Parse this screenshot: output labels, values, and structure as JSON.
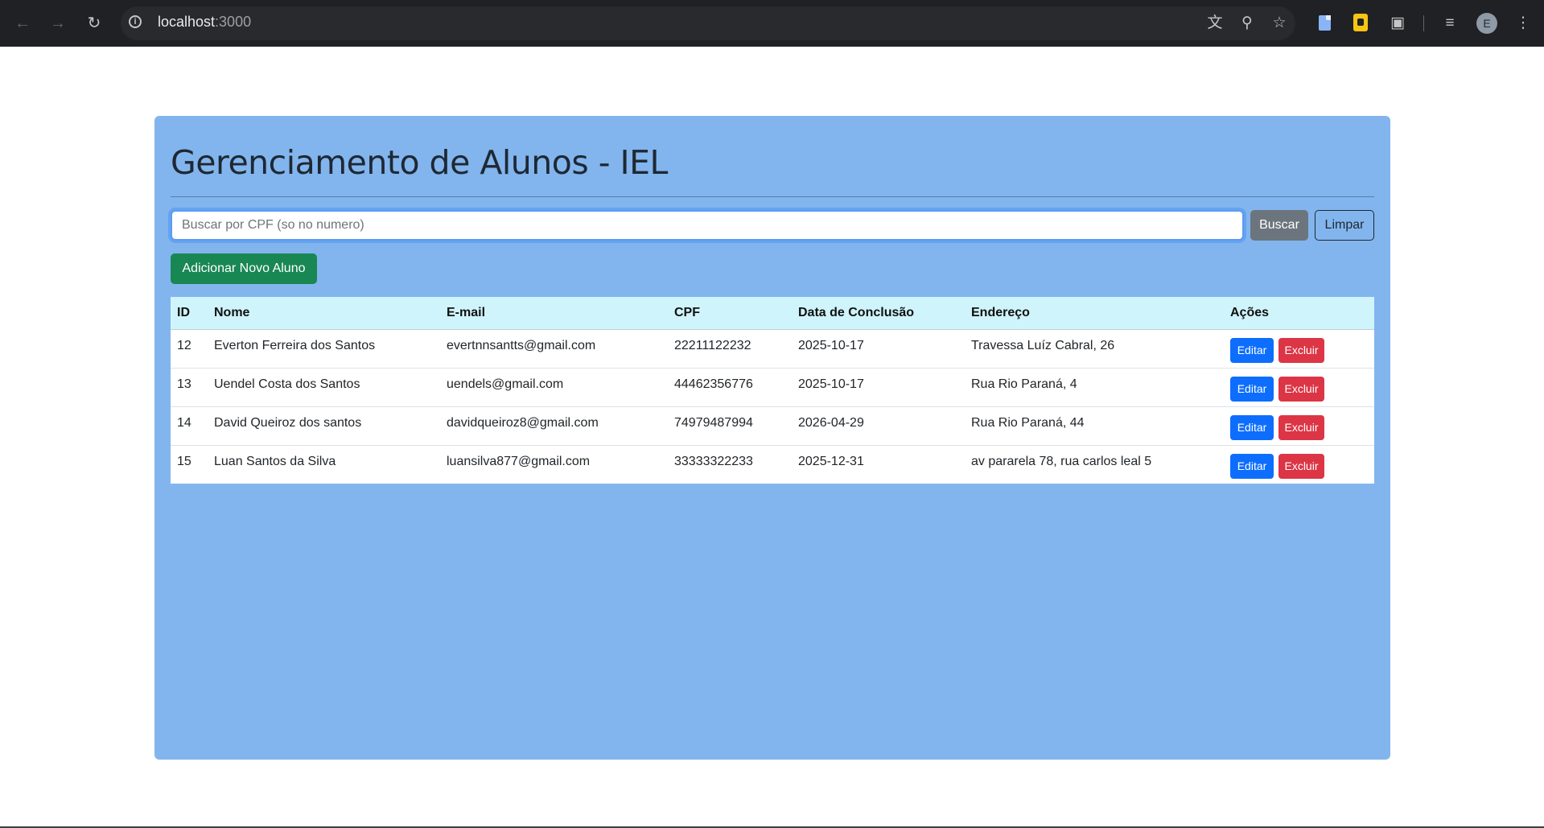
{
  "browser": {
    "url_host": "localhost",
    "url_port": ":3000",
    "avatar_letter": "E"
  },
  "page": {
    "title": "Gerenciamento de Alunos - IEL",
    "search": {
      "placeholder": "Buscar por CPF (so no numero)",
      "value": ""
    },
    "buscar_label": "Buscar",
    "limpar_label": "Limpar",
    "add_label": "Adicionar Novo Aluno"
  },
  "table": {
    "headers": [
      "ID",
      "Nome",
      "E-mail",
      "CPF",
      "Data de Conclusão",
      "Endereço",
      "Ações"
    ],
    "rows": [
      {
        "id": "12",
        "nome": "Everton Ferreira dos Santos",
        "email": "evertnnsantts@gmail.com",
        "cpf": "22211122232",
        "data": "2025-10-17",
        "endereco": "Travessa Luíz Cabral, 26"
      },
      {
        "id": "13",
        "nome": "Uendel Costa dos Santos",
        "email": "uendels@gmail.com",
        "cpf": "44462356776",
        "data": "2025-10-17",
        "endereco": "Rua Rio Paraná, 4"
      },
      {
        "id": "14",
        "nome": "David Queiroz dos santos",
        "email": "davidqueiroz8@gmail.com",
        "cpf": "74979487994",
        "data": "2026-04-29",
        "endereco": "Rua Rio Paraná, 44"
      },
      {
        "id": "15",
        "nome": "Luan Santos da Silva",
        "email": "luansilva877@gmail.com",
        "cpf": "33333322233",
        "data": "2025-12-31",
        "endereco": "av pararela 78, rua carlos leal 5"
      }
    ],
    "edit_label": "Editar",
    "delete_label": "Excluir"
  },
  "colors": {
    "panel": "#82b5ed",
    "header_row": "#cff4fc",
    "primary": "#0d6efd",
    "danger": "#dc3545",
    "success": "#198754",
    "secondary": "#6c757d"
  },
  "icons": [
    "back-arrow-icon",
    "forward-arrow-icon",
    "reload-icon",
    "site-info-icon",
    "translate-icon",
    "zoom-icon",
    "bookmark-star-icon",
    "extensions-icon",
    "media-control-icon",
    "menu-kebab-icon"
  ]
}
